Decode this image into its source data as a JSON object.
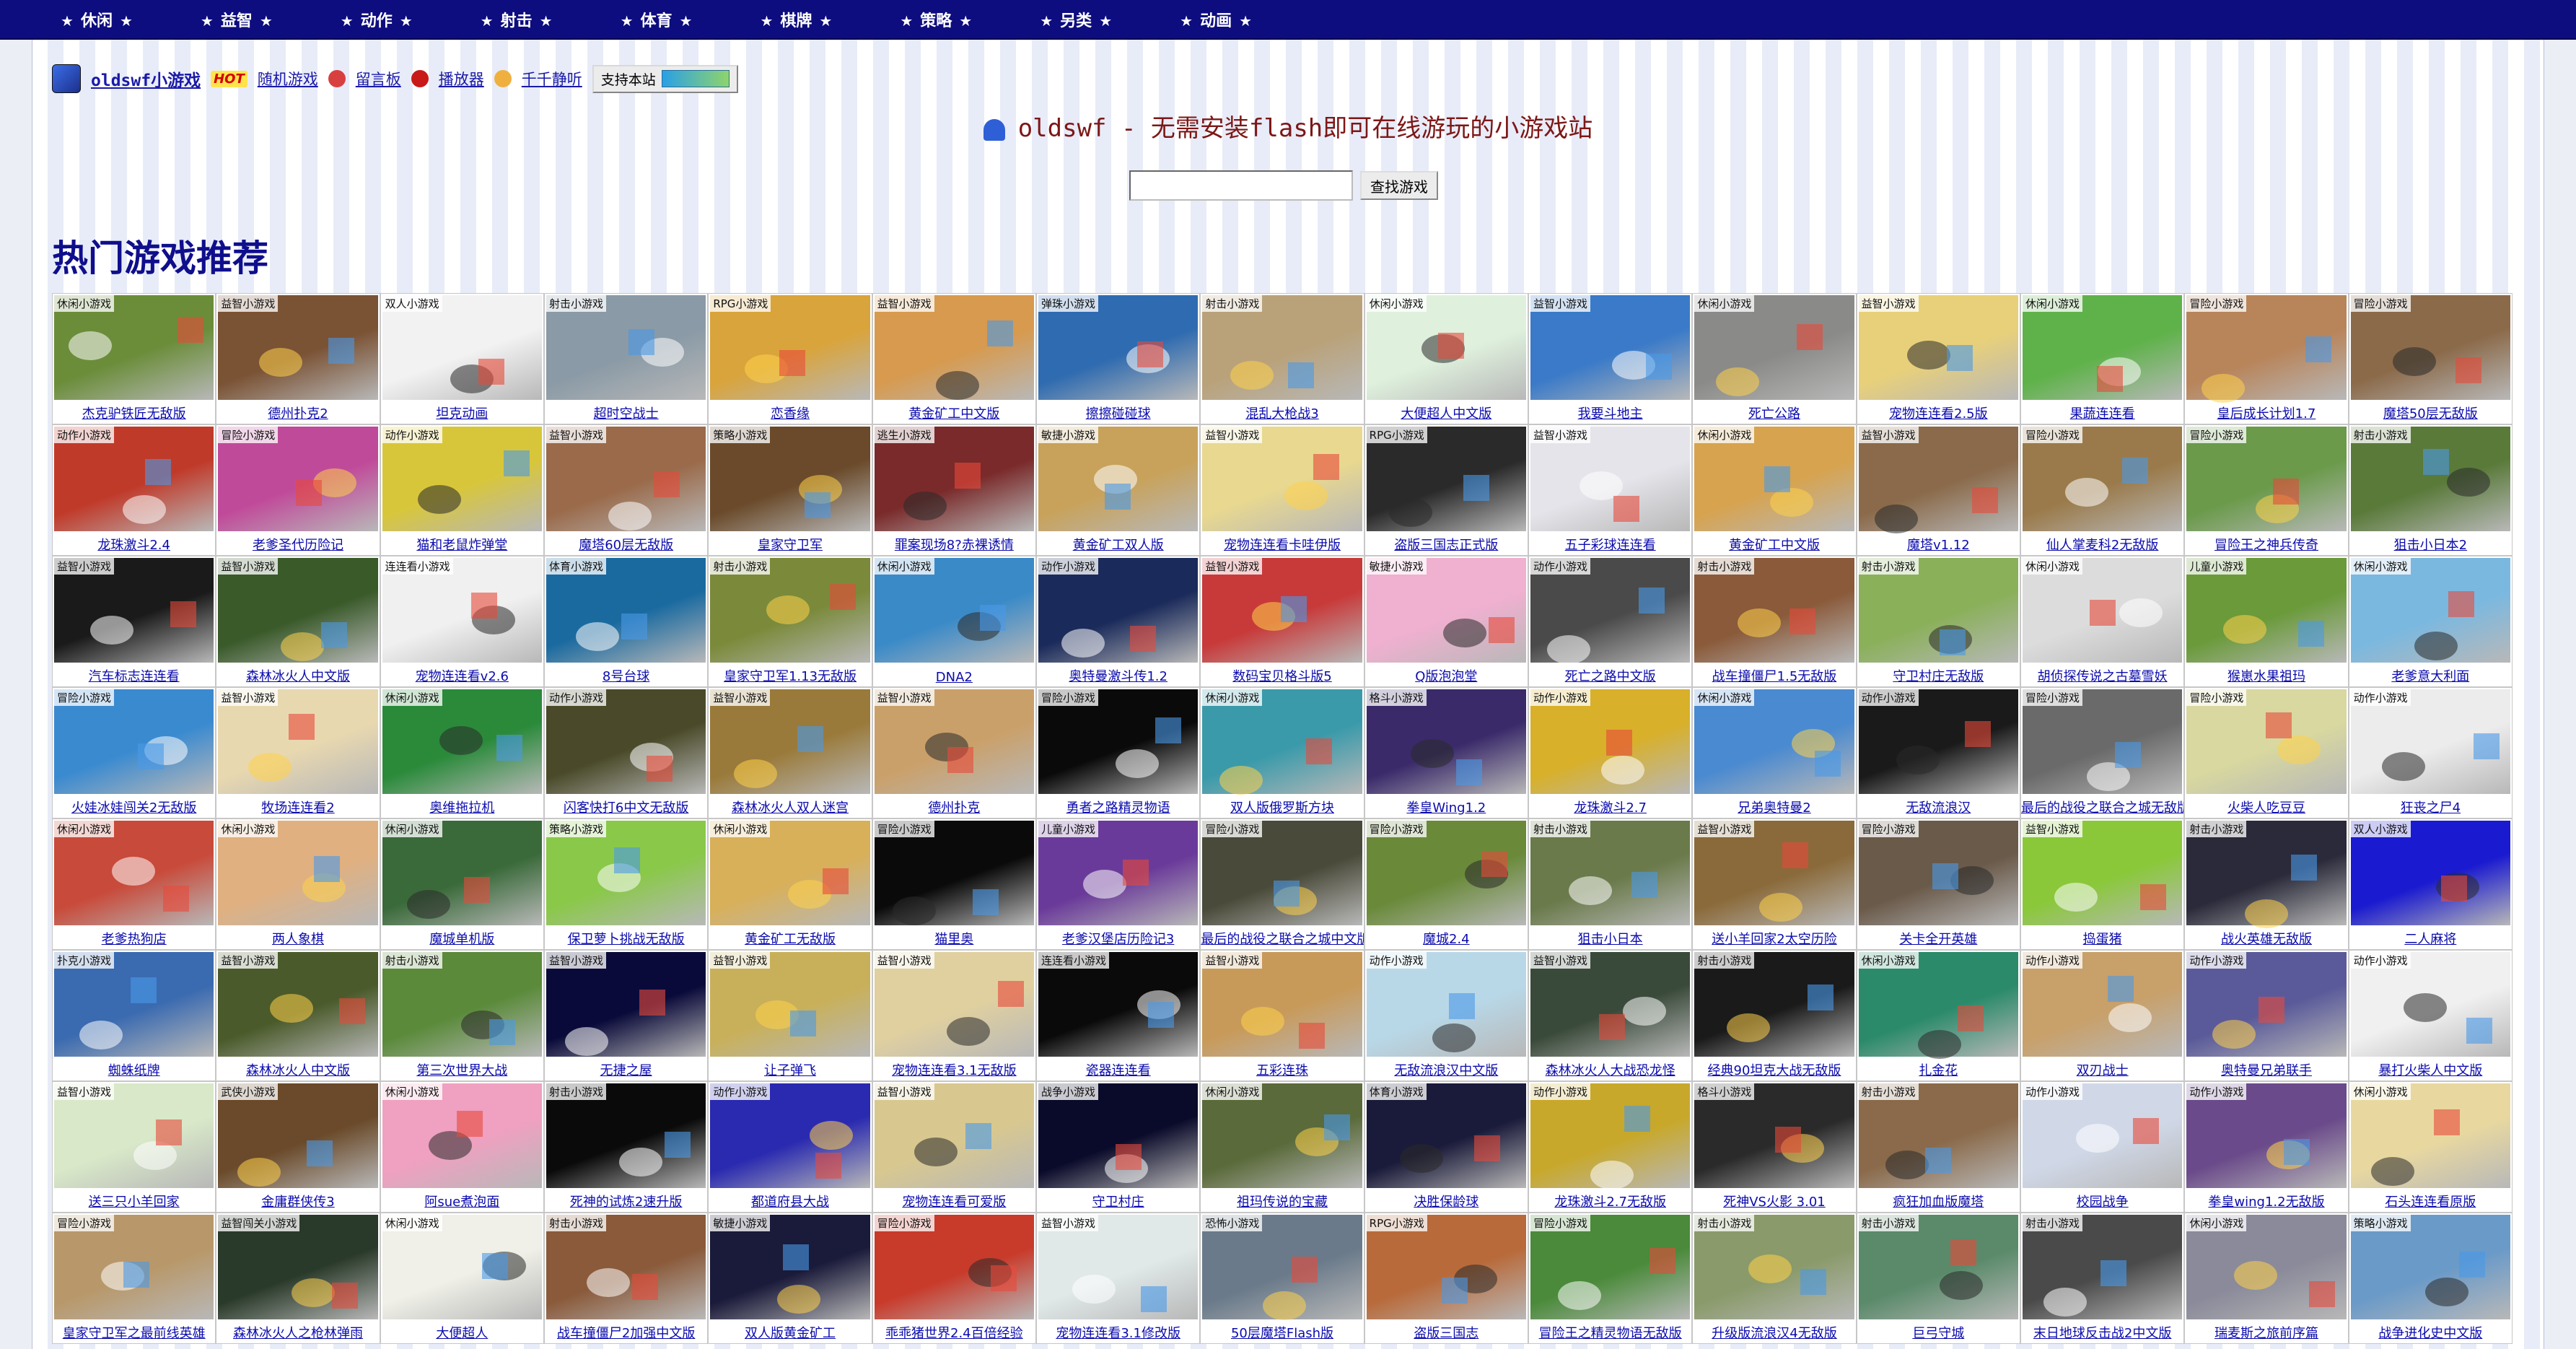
{
  "nav": {
    "items": [
      "休闲",
      "益智",
      "动作",
      "射击",
      "体育",
      "棋牌",
      "策略",
      "另类",
      "动画"
    ],
    "star": "★"
  },
  "toolbar": {
    "site_name": "oldswf小游戏",
    "hot": "HOT",
    "random": "随机游戏",
    "guestbook": "留言板",
    "player": "播放器",
    "listen": "千千静听",
    "support": "支持本站"
  },
  "tagline": "oldswf - 无需安装flash即可在线游玩的小游戏站",
  "search": {
    "value": "",
    "button": "查找游戏"
  },
  "section_title": "热门游戏推荐",
  "games": [
    {
      "cat": "休闲小游戏",
      "name": "杰克驴铁匠无敌版",
      "color": "#6b8d3a"
    },
    {
      "cat": "益智小游戏",
      "name": "德州扑克2",
      "color": "#7a5234"
    },
    {
      "cat": "双人小游戏",
      "name": "坦克动画",
      "color": "#f2f2f2"
    },
    {
      "cat": "射击小游戏",
      "name": "超时空战士",
      "color": "#8a9aa6"
    },
    {
      "cat": "RPG小游戏",
      "name": "恋香缘",
      "color": "#d9a43b"
    },
    {
      "cat": "益智小游戏",
      "name": "黄金矿工中文版",
      "color": "#d79a4e"
    },
    {
      "cat": "弹珠小游戏",
      "name": "擦擦碰碰球",
      "color": "#2f6bb0"
    },
    {
      "cat": "射击小游戏",
      "name": "混乱大枪战3",
      "color": "#b9a27a"
    },
    {
      "cat": "休闲小游戏",
      "name": "大便超人中文版",
      "color": "#dff1dd"
    },
    {
      "cat": "益智小游戏",
      "name": "我要斗地主",
      "color": "#3a7ac8"
    },
    {
      "cat": "休闲小游戏",
      "name": "死亡公路",
      "color": "#8a8a88"
    },
    {
      "cat": "益智小游戏",
      "name": "宠物连连看2.5版",
      "color": "#e8d07a"
    },
    {
      "cat": "休闲小游戏",
      "name": "果蔬连连看",
      "color": "#5fb24a"
    },
    {
      "cat": "冒险小游戏",
      "name": "皇后成长计划1.7",
      "color": "#b8845a"
    },
    {
      "cat": "冒险小游戏",
      "name": "魔塔50层无敌版",
      "color": "#8b6a4a"
    },
    {
      "cat": "动作小游戏",
      "name": "龙珠激斗2.4",
      "color": "#c03a2a"
    },
    {
      "cat": "冒险小游戏",
      "name": "老爹圣代历险记",
      "color": "#c04a9a"
    },
    {
      "cat": "动作小游戏",
      "name": "猫和老鼠炸弹堂",
      "color": "#d8c63a"
    },
    {
      "cat": "益智小游戏",
      "name": "魔塔60层无敌版",
      "color": "#9a6a4a"
    },
    {
      "cat": "策略小游戏",
      "name": "皇家守卫军",
      "color": "#6a4a2a"
    },
    {
      "cat": "逃生小游戏",
      "name": "罪案现场8?赤裸诱情",
      "color": "#7a2a2a"
    },
    {
      "cat": "敏捷小游戏",
      "name": "黄金矿工双人版",
      "color": "#c8a25a"
    },
    {
      "cat": "益智小游戏",
      "name": "宠物连连看卡哇伊版",
      "color": "#e8d890"
    },
    {
      "cat": "RPG小游戏",
      "name": "盗版三国志正式版",
      "color": "#2a2a2a"
    },
    {
      "cat": "益智小游戏",
      "name": "五子彩球连连看",
      "color": "#e4e4ea"
    },
    {
      "cat": "休闲小游戏",
      "name": "黄金矿工中文版",
      "color": "#d7a34e"
    },
    {
      "cat": "益智小游戏",
      "name": "魔塔v1.12",
      "color": "#8a6a4a"
    },
    {
      "cat": "冒险小游戏",
      "name": "仙人掌麦科2无敌版",
      "color": "#9a7a4a"
    },
    {
      "cat": "冒险小游戏",
      "name": "冒险王之神兵传奇",
      "color": "#6a9a4a"
    },
    {
      "cat": "射击小游戏",
      "name": "狙击小日本2",
      "color": "#5a7a3a"
    },
    {
      "cat": "益智小游戏",
      "name": "汽车标志连连看",
      "color": "#1a1a1a"
    },
    {
      "cat": "益智小游戏",
      "name": "森林冰火人中文版",
      "color": "#3a5a2a"
    },
    {
      "cat": "连连看小游戏",
      "name": "宠物连连看v2.6",
      "color": "#f0f0f0"
    },
    {
      "cat": "体育小游戏",
      "name": "8号台球",
      "color": "#1a6aa0"
    },
    {
      "cat": "射击小游戏",
      "name": "皇家守卫军1.13无敌版",
      "color": "#7a8a3a"
    },
    {
      "cat": "休闲小游戏",
      "name": "DNA2",
      "color": "#3a8ac8"
    },
    {
      "cat": "动作小游戏",
      "name": "奥特曼激斗传1.2",
      "color": "#1a2a5a"
    },
    {
      "cat": "益智小游戏",
      "name": "数码宝贝格斗版5",
      "color": "#c83a3a"
    },
    {
      "cat": "敏捷小游戏",
      "name": "Q版泡泡堂",
      "color": "#f0b0d0"
    },
    {
      "cat": "动作小游戏",
      "name": "死亡之路中文版",
      "color": "#4a4a4a"
    },
    {
      "cat": "射击小游戏",
      "name": "战车撞僵尸1.5无敌版",
      "color": "#8a5a3a"
    },
    {
      "cat": "射击小游戏",
      "name": "守卫村庄无敌版",
      "color": "#8ab05a"
    },
    {
      "cat": "休闲小游戏",
      "name": "胡侦探传说之古墓雪妖",
      "color": "#dcdcdc"
    },
    {
      "cat": "儿童小游戏",
      "name": "猴崽水果祖玛",
      "color": "#6a9a3a"
    },
    {
      "cat": "休闲小游戏",
      "name": "老爹意大利面",
      "color": "#7ab8e0"
    },
    {
      "cat": "冒险小游戏",
      "name": "火娃冰娃闯关2无敌版",
      "color": "#3a8ad0"
    },
    {
      "cat": "益智小游戏",
      "name": "牧场连连看2",
      "color": "#e8d8b0"
    },
    {
      "cat": "休闲小游戏",
      "name": "奥维拖拉机",
      "color": "#2a8a3a"
    },
    {
      "cat": "动作小游戏",
      "name": "闪客快打6中文无敌版",
      "color": "#4a4a2a"
    },
    {
      "cat": "益智小游戏",
      "name": "森林冰火人双人迷宫",
      "color": "#9a7a3a"
    },
    {
      "cat": "益智小游戏",
      "name": "德州扑克",
      "color": "#caa06a"
    },
    {
      "cat": "冒险小游戏",
      "name": "勇者之路精灵物语",
      "color": "#0a0a0a"
    },
    {
      "cat": "休闲小游戏",
      "name": "双人版俄罗斯方块",
      "color": "#3a9aaa"
    },
    {
      "cat": "格斗小游戏",
      "name": "拳皇Wing1.2",
      "color": "#3a2a6a"
    },
    {
      "cat": "动作小游戏",
      "name": "龙珠激斗2.7",
      "color": "#d8b02a"
    },
    {
      "cat": "休闲小游戏",
      "name": "兄弟奥特曼2",
      "color": "#4a8ad0"
    },
    {
      "cat": "动作小游戏",
      "name": "无敌流浪汉",
      "color": "#1a1a1a"
    },
    {
      "cat": "冒险小游戏",
      "name": "最后的战役之联合之城无敌版",
      "color": "#6a6a6a"
    },
    {
      "cat": "冒险小游戏",
      "name": "火柴人吃豆豆",
      "color": "#d8d8a0"
    },
    {
      "cat": "动作小游戏",
      "name": "狂丧之尸4",
      "color": "#ececec"
    },
    {
      "cat": "休闲小游戏",
      "name": "老爹热狗店",
      "color": "#c84a3a"
    },
    {
      "cat": "休闲小游戏",
      "name": "两人象棋",
      "color": "#e0b080"
    },
    {
      "cat": "休闲小游戏",
      "name": "魔城单机版",
      "color": "#3a6a3a"
    },
    {
      "cat": "策略小游戏",
      "name": "保卫萝卜挑战无敌版",
      "color": "#8ac84a"
    },
    {
      "cat": "休闲小游戏",
      "name": "黄金矿工无敌版",
      "color": "#d8b05a"
    },
    {
      "cat": "冒险小游戏",
      "name": "猫里奥",
      "color": "#0a0a0a"
    },
    {
      "cat": "儿童小游戏",
      "name": "老爹汉堡店历险记3",
      "color": "#6a3a9a"
    },
    {
      "cat": "冒险小游戏",
      "name": "最后的战役之联合之城中文版",
      "color": "#4a4a3a"
    },
    {
      "cat": "冒险小游戏",
      "name": "魔城2.4",
      "color": "#6a8a3a"
    },
    {
      "cat": "射击小游戏",
      "name": "狙击小日本",
      "color": "#6a7a4a"
    },
    {
      "cat": "益智小游戏",
      "name": "送小羊回家2太空历险",
      "color": "#8a6a3a"
    },
    {
      "cat": "冒险小游戏",
      "name": "关卡全开英雄",
      "color": "#6a5a4a"
    },
    {
      "cat": "益智小游戏",
      "name": "捣蛋猪",
      "color": "#8ac83a"
    },
    {
      "cat": "射击小游戏",
      "name": "战火英雄无敌版",
      "color": "#2a2a3a"
    },
    {
      "cat": "双人小游戏",
      "name": "二人麻将",
      "color": "#1a1ad0"
    },
    {
      "cat": "扑克小游戏",
      "name": "蜘蛛纸牌",
      "color": "#3a6ab0"
    },
    {
      "cat": "益智小游戏",
      "name": "森林冰火人中文版",
      "color": "#4a5a2a"
    },
    {
      "cat": "射击小游戏",
      "name": "第三次世界大战",
      "color": "#5a8a3a"
    },
    {
      "cat": "益智小游戏",
      "name": "无捷之屋",
      "color": "#0a0a3a"
    },
    {
      "cat": "益智小游戏",
      "name": "让子弹飞",
      "color": "#c8b05a"
    },
    {
      "cat": "益智小游戏",
      "name": "宠物连连看3.1无敌版",
      "color": "#e0d0a0"
    },
    {
      "cat": "连连看小游戏",
      "name": "瓷器连连看",
      "color": "#0a0a0a"
    },
    {
      "cat": "益智小游戏",
      "name": "五彩连珠",
      "color": "#c89a5a"
    },
    {
      "cat": "动作小游戏",
      "name": "无敌流浪汉中文版",
      "color": "#b8d8e8"
    },
    {
      "cat": "益智小游戏",
      "name": "森林冰火人大战恐龙怪",
      "color": "#3a4a3a"
    },
    {
      "cat": "射击小游戏",
      "name": "经典90坦克大战无敌版",
      "color": "#1a1a1a"
    },
    {
      "cat": "休闲小游戏",
      "name": "扎金花",
      "color": "#2a8a6a"
    },
    {
      "cat": "动作小游戏",
      "name": "双刃战士",
      "color": "#c8a06a"
    },
    {
      "cat": "动作小游戏",
      "name": "奥特曼兄弟联手",
      "color": "#5a5a9a"
    },
    {
      "cat": "动作小游戏",
      "name": "暴打火柴人中文版",
      "color": "#f0f0f0"
    },
    {
      "cat": "益智小游戏",
      "name": "送三只小羊回家",
      "color": "#d8e8c8"
    },
    {
      "cat": "武侠小游戏",
      "name": "金庸群侠传3",
      "color": "#6a4a2a"
    },
    {
      "cat": "休闲小游戏",
      "name": "阿sue煮泡面",
      "color": "#f0a0c0"
    },
    {
      "cat": "射击小游戏",
      "name": "死神的试炼2速升版",
      "color": "#0a0a0a"
    },
    {
      "cat": "动作小游戏",
      "name": "都道府县大战",
      "color": "#2a2ab0"
    },
    {
      "cat": "益智小游戏",
      "name": "宠物连连看可爱版",
      "color": "#d8c890"
    },
    {
      "cat": "战争小游戏",
      "name": "守卫村庄",
      "color": "#0a0a2a"
    },
    {
      "cat": "休闲小游戏",
      "name": "祖玛传说的宝藏",
      "color": "#5a6a3a"
    },
    {
      "cat": "体育小游戏",
      "name": "决胜保龄球",
      "color": "#1a1a3a"
    },
    {
      "cat": "动作小游戏",
      "name": "龙珠激斗2.7无敌版",
      "color": "#c8a82a"
    },
    {
      "cat": "格斗小游戏",
      "name": "死神VS火影 3.01",
      "color": "#2a2a2a"
    },
    {
      "cat": "射击小游戏",
      "name": "疯狂加血版魔塔",
      "color": "#8a6a4a"
    },
    {
      "cat": "动作小游戏",
      "name": "校园战争",
      "color": "#d0d8e8"
    },
    {
      "cat": "动作小游戏",
      "name": "拳皇wing1.2无敌版",
      "color": "#6a4a8a"
    },
    {
      "cat": "休闲小游戏",
      "name": "石头连连看原版",
      "color": "#e8d8a0"
    },
    {
      "cat": "冒险小游戏",
      "name": "皇家守卫军之最前线英雄",
      "color": "#b8986a"
    },
    {
      "cat": "益智闯关小游戏",
      "name": "森林冰火人之枪林弹雨",
      "color": "#2a3a2a"
    },
    {
      "cat": "休闲小游戏",
      "name": "大便超人",
      "color": "#f0f0e8"
    },
    {
      "cat": "射击小游戏",
      "name": "战车撞僵尸2加强中文版",
      "color": "#8a5a3a"
    },
    {
      "cat": "敏捷小游戏",
      "name": "双人版黄金矿工",
      "color": "#1a1a3a"
    },
    {
      "cat": "冒险小游戏",
      "name": "乖乖猪世界2.4百倍经验",
      "color": "#c83a2a"
    },
    {
      "cat": "益智小游戏",
      "name": "宠物连连看3.1修改版",
      "color": "#e0e8e8"
    },
    {
      "cat": "恐怖小游戏",
      "name": "50层魔塔Flash版",
      "color": "#6a7a8a"
    },
    {
      "cat": "RPG小游戏",
      "name": "盗版三国志",
      "color": "#b86a3a"
    },
    {
      "cat": "冒险小游戏",
      "name": "冒险王之精灵物语无敌版",
      "color": "#4a8a3a"
    },
    {
      "cat": "射击小游戏",
      "name": "升级版流浪汉4无敌版",
      "color": "#8a9a6a"
    },
    {
      "cat": "射击小游戏",
      "name": "巨弓守城",
      "color": "#5a8a6a"
    },
    {
      "cat": "射击小游戏",
      "name": "末日地球反击战2中文版",
      "color": "#4a4a4a"
    },
    {
      "cat": "休闲小游戏",
      "name": "瑞麦斯之旅前序篇",
      "color": "#8a8a9a"
    },
    {
      "cat": "策略小游戏",
      "name": "战争进化史中文版",
      "color": "#6a9ac8"
    }
  ]
}
